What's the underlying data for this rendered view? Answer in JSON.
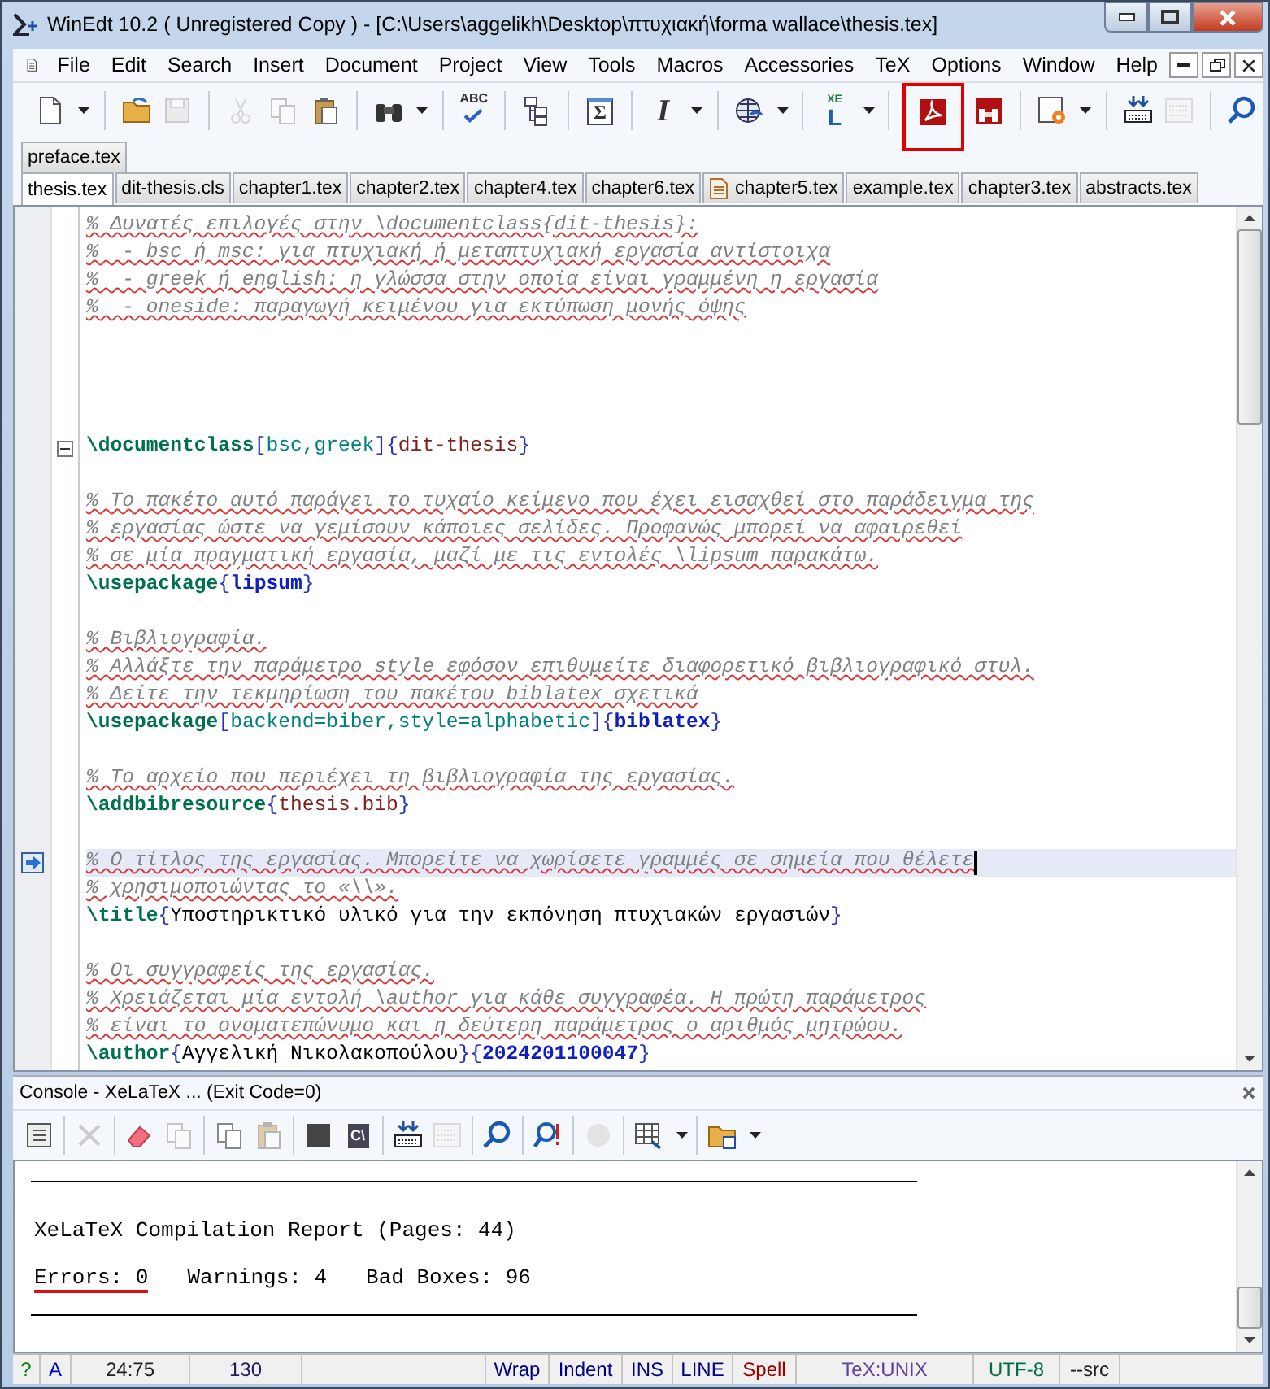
{
  "window": {
    "title": "WinEdt 10.2  ( Unregistered  Copy )  - [C:\\Users\\aggelikh\\Desktop\\πτυχιακή\\forma wallace\\thesis.tex]"
  },
  "menu": [
    "File",
    "Edit",
    "Search",
    "Insert",
    "Document",
    "Project",
    "View",
    "Tools",
    "Macros",
    "Accessories",
    "TeX",
    "Options",
    "Window",
    "Help"
  ],
  "toolbar": [
    {
      "kind": "new",
      "dropdown": true,
      "disabled": false
    },
    {
      "kind": "separator"
    },
    {
      "kind": "open",
      "dropdown": false,
      "disabled": false
    },
    {
      "kind": "save",
      "dropdown": false,
      "disabled": true
    },
    {
      "kind": "separator"
    },
    {
      "kind": "cut",
      "dropdown": false,
      "disabled": true
    },
    {
      "kind": "copy",
      "dropdown": false,
      "disabled": true
    },
    {
      "kind": "paste",
      "dropdown": false,
      "disabled": false
    },
    {
      "kind": "separator"
    },
    {
      "kind": "find",
      "dropdown": true,
      "disabled": false
    },
    {
      "kind": "separator"
    },
    {
      "kind": "spell",
      "label": "ABC",
      "dropdown": false,
      "disabled": false
    },
    {
      "kind": "separator"
    },
    {
      "kind": "tree",
      "dropdown": false,
      "disabled": false
    },
    {
      "kind": "separator"
    },
    {
      "kind": "sigma",
      "label": "Σ",
      "dropdown": false,
      "disabled": false
    },
    {
      "kind": "separator"
    },
    {
      "kind": "italic",
      "label": "I",
      "dropdown": true,
      "disabled": false
    },
    {
      "kind": "separator"
    },
    {
      "kind": "globe",
      "dropdown": true,
      "disabled": false
    },
    {
      "kind": "separator"
    },
    {
      "kind": "xelatex",
      "label": "L",
      "sup": "XE",
      "dropdown": true,
      "disabled": false
    },
    {
      "kind": "separator"
    },
    {
      "kind": "pdf",
      "dropdown": false,
      "disabled": false,
      "highlighted": true
    },
    {
      "kind": "pdfsearch",
      "dropdown": false,
      "disabled": false
    },
    {
      "kind": "separator"
    },
    {
      "kind": "config",
      "dropdown": true,
      "disabled": false
    },
    {
      "kind": "separator"
    },
    {
      "kind": "kbddown",
      "dropdown": false,
      "disabled": false
    },
    {
      "kind": "kbd",
      "dropdown": false,
      "disabled": true
    },
    {
      "kind": "separator"
    },
    {
      "kind": "search",
      "dropdown": false,
      "disabled": false
    }
  ],
  "tab_rows": [
    [
      {
        "label": "preface.tex",
        "selected": false,
        "doc_icon": false
      }
    ],
    [
      {
        "label": "thesis.tex",
        "selected": true,
        "doc_icon": false
      },
      {
        "label": "dit-thesis.cls",
        "selected": false,
        "doc_icon": false
      },
      {
        "label": "chapter1.tex",
        "selected": false,
        "doc_icon": false
      },
      {
        "label": "chapter2.tex",
        "selected": false,
        "doc_icon": false
      },
      {
        "label": "chapter4.tex",
        "selected": false,
        "doc_icon": false
      },
      {
        "label": "chapter6.tex",
        "selected": false,
        "doc_icon": false
      },
      {
        "label": "chapter5.tex",
        "selected": false,
        "doc_icon": true
      },
      {
        "label": "example.tex",
        "selected": false,
        "doc_icon": false
      },
      {
        "label": "chapter3.tex",
        "selected": false,
        "doc_icon": false
      },
      {
        "label": "abstracts.tex",
        "selected": false,
        "doc_icon": false
      }
    ]
  ],
  "editor": {
    "lines": [
      {
        "current": false,
        "fold": false,
        "segments": [
          {
            "kind": "comment",
            "text": "% Δυνατές επιλογές στην \\documentclass{dit-thesis}:"
          }
        ]
      },
      {
        "current": false,
        "fold": false,
        "segments": [
          {
            "kind": "comment",
            "text": "%  - bsc ή msc: για πτυχιακή ή μεταπτυχιακή εργασία αντίστοιχα"
          }
        ]
      },
      {
        "current": false,
        "fold": false,
        "segments": [
          {
            "kind": "comment",
            "text": "%  - greek ή english: η γλώσσα στην οποία είναι γραμμένη η εργασία"
          }
        ]
      },
      {
        "current": false,
        "fold": false,
        "segments": [
          {
            "kind": "comment",
            "text": "%  - oneside: παραγωγή κειμένου για εκτύπωση μονής όψης"
          }
        ]
      },
      {
        "current": false,
        "fold": false
      },
      {
        "current": false,
        "fold": false
      },
      {
        "current": false,
        "fold": false
      },
      {
        "current": false,
        "fold": false
      },
      {
        "current": false,
        "fold": true,
        "segments": [
          {
            "kind": "cmd",
            "text": "\\documentclass"
          },
          {
            "kind": "brace",
            "text": "["
          },
          {
            "kind": "opt",
            "text": "bsc,greek"
          },
          {
            "kind": "brace",
            "text": "]{"
          },
          {
            "kind": "arg",
            "text": "dit-thesis"
          },
          {
            "kind": "brace",
            "text": "}"
          }
        ]
      },
      {
        "current": false,
        "fold": false
      },
      {
        "current": false,
        "fold": false,
        "segments": [
          {
            "kind": "comment",
            "text": "% Το πακέτο αυτό παράγει το τυχαίο κείμενο που έχει εισαχθεί στο παράδειγμα της"
          }
        ]
      },
      {
        "current": false,
        "fold": false,
        "segments": [
          {
            "kind": "comment",
            "text": "% εργασίας ώστε να γεμίσουν κάποιες σελίδες. Προφανώς μπορεί να αφαιρεθεί"
          }
        ]
      },
      {
        "current": false,
        "fold": false,
        "segments": [
          {
            "kind": "comment",
            "text": "% σε μία πραγματική εργασία, μαζί με τις εντολές \\lipsum παρακάτω."
          }
        ]
      },
      {
        "current": false,
        "fold": false,
        "segments": [
          {
            "kind": "cmd",
            "text": "\\usepackage"
          },
          {
            "kind": "brace",
            "text": "{"
          },
          {
            "kind": "pkg",
            "text": "lipsum"
          },
          {
            "kind": "brace",
            "text": "}"
          }
        ]
      },
      {
        "current": false,
        "fold": false
      },
      {
        "current": false,
        "fold": false,
        "segments": [
          {
            "kind": "comment",
            "text": "% Βιβλιογραφία."
          }
        ]
      },
      {
        "current": false,
        "fold": false,
        "segments": [
          {
            "kind": "comment",
            "text": "% Αλλάξτε την παράμετρο style εφόσον επιθυμείτε διαφορετικό βιβλιογραφικό στυλ."
          }
        ]
      },
      {
        "current": false,
        "fold": false,
        "segments": [
          {
            "kind": "comment",
            "text": "% Δείτε την τεκμηρίωση του πακέτου biblatex σχετικά"
          }
        ]
      },
      {
        "current": false,
        "fold": false,
        "segments": [
          {
            "kind": "cmd",
            "text": "\\usepackage"
          },
          {
            "kind": "brace",
            "text": "["
          },
          {
            "kind": "opt",
            "text": "backend=biber,style=alphabetic"
          },
          {
            "kind": "brace",
            "text": "]{"
          },
          {
            "kind": "pkg",
            "text": "biblatex"
          },
          {
            "kind": "brace",
            "text": "}"
          }
        ]
      },
      {
        "current": false,
        "fold": false
      },
      {
        "current": false,
        "fold": false,
        "segments": [
          {
            "kind": "comment",
            "text": "% Το αρχείο που περιέχει τη βιβλιογραφία της εργασίας."
          }
        ]
      },
      {
        "current": false,
        "fold": false,
        "segments": [
          {
            "kind": "cmd",
            "text": "\\addbibresource"
          },
          {
            "kind": "brace",
            "text": "{"
          },
          {
            "kind": "arg",
            "text": "thesis.bib"
          },
          {
            "kind": "brace",
            "text": "}"
          }
        ]
      },
      {
        "current": false,
        "fold": false
      },
      {
        "current": true,
        "fold": false,
        "segments": [
          {
            "kind": "comment",
            "text": "% Ο τίτλος της εργασίας. Μπορείτε να χωρίσετε γραμμές σε σημεία που θέλετε"
          }
        ]
      },
      {
        "current": false,
        "fold": false,
        "segments": [
          {
            "kind": "comment",
            "text": "% χρησιμοποιώντας το «\\\\»."
          }
        ]
      },
      {
        "current": false,
        "fold": false,
        "segments": [
          {
            "kind": "cmd",
            "text": "\\title"
          },
          {
            "kind": "brace",
            "text": "{"
          },
          {
            "kind": "text",
            "text": "Υποστηρικτικό υλικό για την εκπόνηση πτυχιακών εργασιών"
          },
          {
            "kind": "brace",
            "text": "}"
          }
        ]
      },
      {
        "current": false,
        "fold": false
      },
      {
        "current": false,
        "fold": false,
        "segments": [
          {
            "kind": "comment",
            "text": "% Οι συγγραφείς της εργασίας."
          }
        ]
      },
      {
        "current": false,
        "fold": false,
        "segments": [
          {
            "kind": "comment",
            "text": "% Χρειάζεται μία εντολή \\author για κάθε συγγραφέα. Η πρώτη παράμετρος"
          }
        ]
      },
      {
        "current": false,
        "fold": false,
        "segments": [
          {
            "kind": "comment",
            "text": "% είναι το ονοματεπώνυμο και η δεύτερη παράμετρος ο αριθμός μητρώου."
          }
        ]
      },
      {
        "current": false,
        "fold": false,
        "segments": [
          {
            "kind": "cmd",
            "text": "\\author"
          },
          {
            "kind": "brace",
            "text": "{"
          },
          {
            "kind": "text",
            "text": "Αγγελική Νικολακοπούλου"
          },
          {
            "kind": "brace",
            "text": "}{"
          },
          {
            "kind": "pkg",
            "text": "2024201100047"
          },
          {
            "kind": "brace",
            "text": "}"
          }
        ]
      }
    ]
  },
  "console": {
    "title": "Console - XeLaTeX ... (Exit Code=0)",
    "toolbar": [
      {
        "kind": "list",
        "dropdown": false,
        "disabled": false
      },
      {
        "kind": "separator"
      },
      {
        "kind": "close",
        "dropdown": false,
        "disabled": true
      },
      {
        "kind": "separator"
      },
      {
        "kind": "eraser",
        "dropdown": false,
        "disabled": false
      },
      {
        "kind": "copy",
        "dropdown": false,
        "disabled": true
      },
      {
        "kind": "separator"
      },
      {
        "kind": "copy",
        "dropdown": false,
        "disabled": false
      },
      {
        "kind": "paste",
        "dropdown": false,
        "disabled": true
      },
      {
        "kind": "separator"
      },
      {
        "kind": "square",
        "dropdown": false,
        "disabled": false
      },
      {
        "kind": "prompt",
        "label": "C\\",
        "dropdown": false,
        "disabled": false
      },
      {
        "kind": "separator"
      },
      {
        "kind": "kbddown",
        "dropdown": false,
        "disabled": false
      },
      {
        "kind": "kbd",
        "dropdown": false,
        "disabled": true
      },
      {
        "kind": "separator"
      },
      {
        "kind": "search",
        "dropdown": false,
        "disabled": false
      },
      {
        "kind": "separator"
      },
      {
        "kind": "searchalert",
        "dropdown": false,
        "disabled": false
      },
      {
        "kind": "separator"
      },
      {
        "kind": "circle",
        "dropdown": false,
        "disabled": true
      },
      {
        "kind": "separator"
      },
      {
        "kind": "table",
        "dropdown": true,
        "disabled": false
      },
      {
        "kind": "separator"
      },
      {
        "kind": "folder",
        "dropdown": true,
        "disabled": false
      }
    ],
    "report_title": "XeLaTeX Compilation Report (Pages: 44)",
    "stats": [
      {
        "text": "Errors: 0",
        "marked": true
      },
      {
        "text": "Warnings: 4",
        "marked": false
      },
      {
        "text": "Bad Boxes: 96",
        "marked": false
      }
    ]
  },
  "status_bar": [
    {
      "kind": "text",
      "text": "?"
    },
    {
      "kind": "text",
      "text": "A"
    },
    {
      "kind": "text",
      "text": "24:75"
    },
    {
      "kind": "text",
      "text": "130"
    },
    {
      "kind": "spacer"
    },
    {
      "kind": "text",
      "text": "Wrap"
    },
    {
      "kind": "text",
      "text": "Indent"
    },
    {
      "kind": "text",
      "text": "INS"
    },
    {
      "kind": "text",
      "text": "LINE"
    },
    {
      "kind": "text",
      "text": "Spell"
    },
    {
      "kind": "text",
      "text": "TeX:UNIX"
    },
    {
      "kind": "text",
      "text": "UTF-8"
    },
    {
      "kind": "text",
      "text": "--src"
    }
  ]
}
